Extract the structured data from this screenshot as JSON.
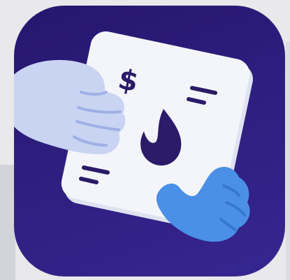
{
  "icon": {
    "name": "invoice-handshake-app-icon",
    "currency_symbol": "$",
    "colors": {
      "background": "#2a1a78",
      "paper": "#f4f5fb",
      "paper_shadow": "#dfe2f0",
      "left_hand": "#c9d4f3",
      "left_hand_outline": "#9fb0e6",
      "right_hand": "#4a90e6",
      "right_hand_outline": "#3778d0",
      "flame": "#2b1b68",
      "text_lines": "#2b1b68"
    }
  }
}
